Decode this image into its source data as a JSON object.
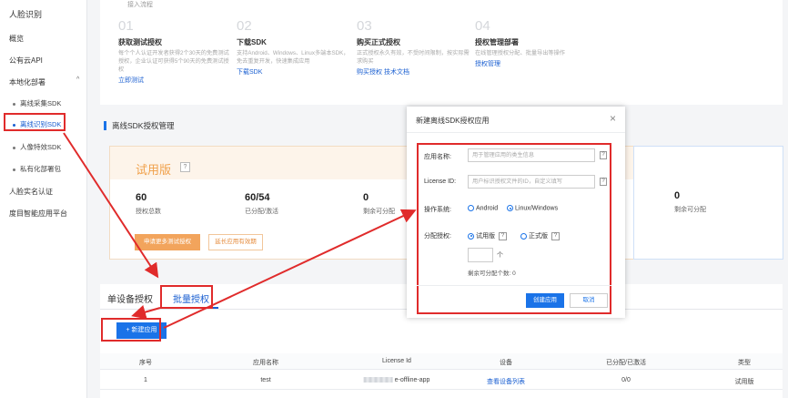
{
  "sidebar": {
    "header": "人脸识别",
    "items": [
      {
        "label": "概览"
      },
      {
        "label": "公有云API"
      },
      {
        "label": "本地化部署"
      },
      {
        "label": "人脸实名认证"
      },
      {
        "label": "度目智能应用平台"
      }
    ],
    "subitems": [
      {
        "label": "离线采集SDK"
      },
      {
        "label": "离线识别SDK"
      },
      {
        "label": "人像特效SDK"
      },
      {
        "label": "私有化部署包"
      }
    ],
    "caret": "^"
  },
  "steps": {
    "section_label": "接入流程",
    "items": [
      {
        "num": "01",
        "title": "获取测试授权",
        "desc": "每个个人认证开发者获得2个30天的免费测试授权，企业认证可获得5个90天的免费测试授权",
        "link": "立即测试"
      },
      {
        "num": "02",
        "title": "下载SDK",
        "desc": "支持Android、Windows、Linux多端本SDK，免去重复开发，快速集成应用",
        "link": "下载SDK"
      },
      {
        "num": "03",
        "title": "购买正式授权",
        "desc": "正式授权永久有效，不受时间限制，按实际需求购买",
        "link": "购买授权  技术文档"
      },
      {
        "num": "04",
        "title": "授权管理部署",
        "desc": "在线管理授权分配、批量导出等操作",
        "link": "授权管理"
      }
    ]
  },
  "manage": {
    "title": "离线SDK授权管理",
    "trial": {
      "title": "试用版",
      "q": "?",
      "stats": [
        {
          "value": "60",
          "label": "授权总数"
        },
        {
          "value": "60/54",
          "label": "已分配/激活"
        },
        {
          "value": "0",
          "label": "剩余可分配"
        }
      ],
      "btn_apply": "申请更多测试授权",
      "btn_extend": "延长应用有效期"
    },
    "right_stat": {
      "value": "0",
      "label": "剩余可分配"
    }
  },
  "tabs": [
    {
      "label": "单设备授权"
    },
    {
      "label": "批量授权"
    }
  ],
  "toolbar": {
    "new_label": "+ 新建应用"
  },
  "table": {
    "headers": [
      "序号",
      "应用名称",
      "License Id",
      "设备",
      "已分配/已激活",
      "类型"
    ],
    "rows": [
      {
        "idx": "1",
        "name": "test",
        "license": "e-offline-app",
        "device": "查看设备列表",
        "assigned": "0/0",
        "type": "试用版"
      }
    ]
  },
  "modal": {
    "title": "新建离线SDK授权应用",
    "close": "×",
    "fields": {
      "app_name_label": "应用名称:",
      "app_name_placeholder": "用于管理应用的类生信息",
      "license_label": "License ID:",
      "license_placeholder": "用户标识授权文件的ID，自定义填写",
      "os_label": "操作系统:",
      "os_android": "Android",
      "os_linux": "Linux/Windows",
      "alloc_label": "分配授权:",
      "alloc_trial": "试用版",
      "alloc_formal": "正式版",
      "qty_unit": "个",
      "remain": "剩余可分配个数: 0",
      "q": "?"
    },
    "btn_create": "创建应用",
    "btn_cancel": "取消"
  }
}
